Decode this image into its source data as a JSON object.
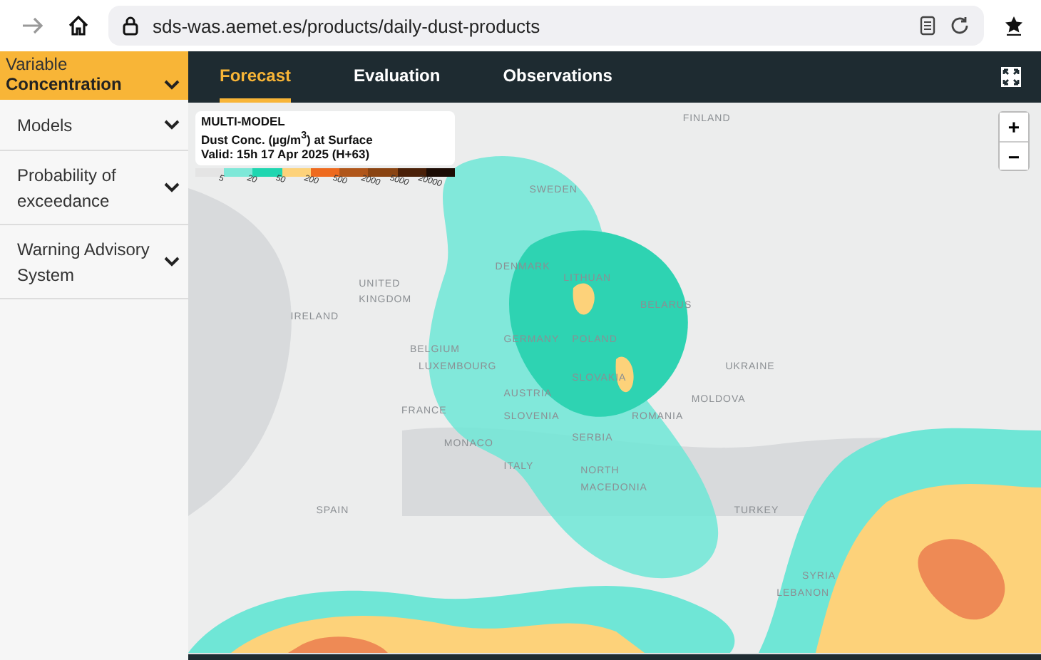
{
  "browser": {
    "url": "sds-was.aemet.es/products/daily-dust-products"
  },
  "sidebar": {
    "variable": {
      "label": "Variable",
      "value": "Concentration"
    },
    "items": [
      {
        "label": "Models",
        "expanded": false
      },
      {
        "label": "Probability of exceedance",
        "expanded": false
      },
      {
        "label": "Warning Advisory System",
        "expanded": false
      }
    ]
  },
  "tabs": [
    {
      "label": "Forecast",
      "selected": true
    },
    {
      "label": "Evaluation",
      "selected": false
    },
    {
      "label": "Observations",
      "selected": false
    }
  ],
  "legend": {
    "title": "MULTI-MODEL",
    "subtitle": "Dust Conc. (µg/m$^{3}$) at Surface",
    "valid": "Valid: 15h 17 Apr 2025 (H+63)",
    "swatches": [
      {
        "color": "#e4e4e4"
      },
      {
        "color": "#7ee8d8"
      },
      {
        "color": "#1fd6b0"
      },
      {
        "color": "#fdd27a"
      },
      {
        "color": "#ee6a1e"
      },
      {
        "color": "#b0561a"
      },
      {
        "color": "#8a4412"
      },
      {
        "color": "#4a2008"
      },
      {
        "color": "#1c0c04"
      }
    ],
    "ticks": [
      "5",
      "20",
      "50",
      "200",
      "500",
      "2000",
      "5000",
      "20000"
    ]
  },
  "zoom": {
    "in": "+",
    "out": "−"
  },
  "map_labels": [
    "FINLAND",
    "SWEDEN",
    "DENMARK",
    "LITHUAN",
    "BELARUS",
    "UNITED",
    "KINGDOM",
    "IRELAND",
    "BELGIUM",
    "LUXEMBOURG",
    "GERMANY",
    "POLAND",
    "UKRAINE",
    "SLOVAKIA",
    "MOLDOVA",
    "AUSTRIA",
    "FRANCE",
    "ROMANIA",
    "SLOVENIA",
    "SERBIA",
    "MONACO",
    "ITALY",
    "NORTH",
    "MACEDONIA",
    "SPAIN",
    "TURKEY",
    "SYRIA",
    "LEBANON"
  ]
}
